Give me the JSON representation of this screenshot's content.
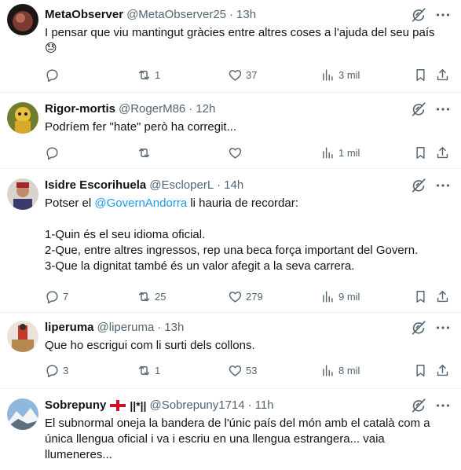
{
  "tweets": [
    {
      "name": "MetaObserver",
      "handle": "@MetaObserver25",
      "time": "13h",
      "text": "I pensar que viu mantingut gràcies entre altres coses a l'ajuda del seu país",
      "emoji": "😓",
      "replies": "",
      "reposts": "1",
      "likes": "37",
      "views": "3 mil"
    },
    {
      "name": "Rigor-mortis",
      "handle": "@RogerM86",
      "time": "12h",
      "text": "Podríem fer \"hate\" però ha corregit...",
      "replies": "",
      "reposts": "",
      "likes": "",
      "views": "1 mil"
    },
    {
      "name": "Isidre Escorihuela",
      "handle": "@EscloperL",
      "time": "14h",
      "text_before_mention": "Potser el ",
      "mention": "@GovernAndorra",
      "text_after_mention": " li hauria de recordar:\n\n1-Quin és el seu idioma oficial.\n2-Que, entre altres ingressos, rep una beca força important del Govern.\n3-Que la dignitat també és un valor afegit a la seva carrera.",
      "replies": "7",
      "reposts": "25",
      "likes": "279",
      "views": "9 mil"
    },
    {
      "name": "liperuma",
      "handle": "@liperuma",
      "time": "13h",
      "text": "Que ho escrigui com li surti dels collons.",
      "replies": "3",
      "reposts": "1",
      "likes": "53",
      "views": "8 mil"
    },
    {
      "name": "Sobrepuny",
      "name_suffix": "||*||",
      "handle": "@Sobrepuny1714",
      "time": "11h",
      "text": "El subnormal oneja la bandera de l'únic país del món amb el català com a única llengua oficial i va i escriu en una llengua estrangera... vaia llumeneres..."
    }
  ],
  "separator": "·",
  "colors": {
    "text": "#0f1419",
    "secondary": "#536471",
    "link": "#1d9bf0",
    "divider": "#eff3f4"
  },
  "icons": [
    "reply-icon",
    "repost-icon",
    "like-icon",
    "views-icon",
    "bookmark-icon",
    "share-icon",
    "grok-icon",
    "more-icon"
  ]
}
